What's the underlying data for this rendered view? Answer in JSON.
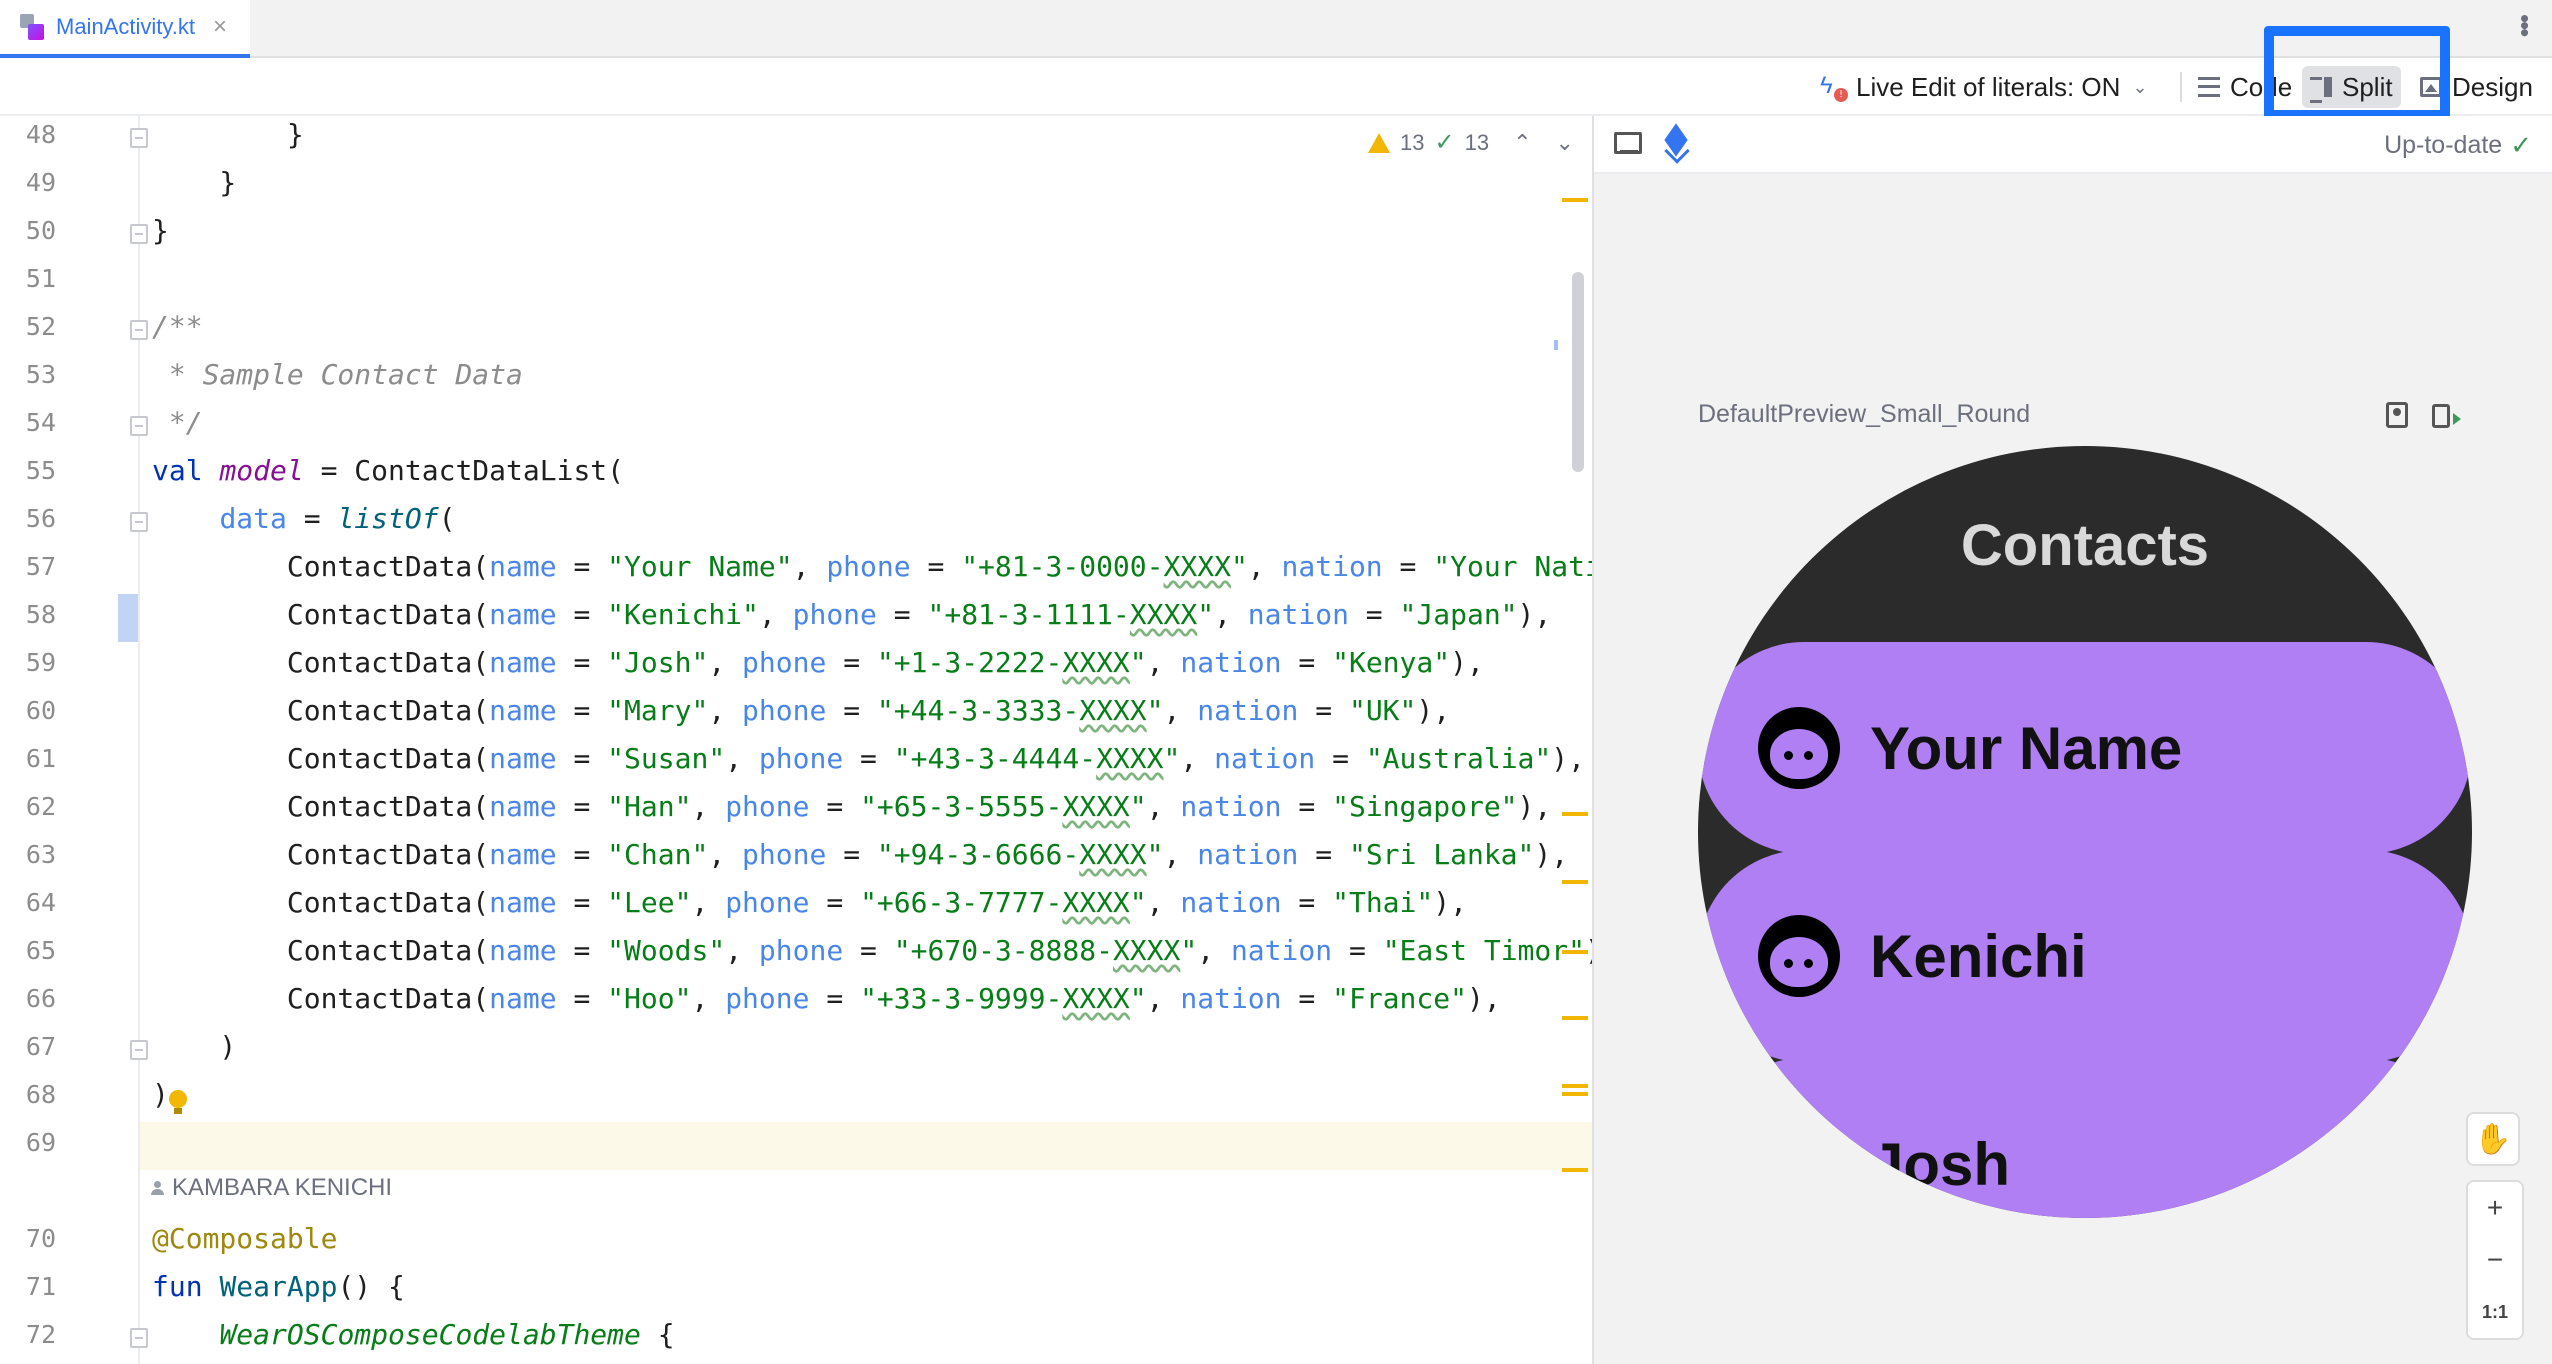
{
  "tab": {
    "title": "MainActivity.kt",
    "close": "×",
    "more": "⋮"
  },
  "toolbar": {
    "live_edit": "Live Edit of literals: ON",
    "live_edit_chevron": "⌄",
    "modes": {
      "code": "Code",
      "split": "Split",
      "design": "Design"
    },
    "selected_mode": "Split",
    "highlight_color": "#1a73ff"
  },
  "editor": {
    "inspections": {
      "warnings": "13",
      "checks": "13"
    },
    "line_numbers": [
      "48",
      "49",
      "50",
      "51",
      "52",
      "53",
      "54",
      "55",
      "56",
      "57",
      "58",
      "59",
      "60",
      "61",
      "62",
      "63",
      "64",
      "65",
      "66",
      "67",
      "68",
      "69",
      "70",
      "71",
      "72"
    ],
    "author": "KAMBARA KENICHI",
    "contacts": [
      {
        "name": "Your Name",
        "phone": "+81-3-0000-XXXX",
        "nation": "Your Nati"
      },
      {
        "name": "Kenichi",
        "phone": "+81-3-1111-XXXX",
        "nation": "Japan"
      },
      {
        "name": "Josh",
        "phone": "+1-3-2222-XXXX",
        "nation": "Kenya"
      },
      {
        "name": "Mary",
        "phone": "+44-3-3333-XXXX",
        "nation": "UK"
      },
      {
        "name": "Susan",
        "phone": "+43-3-4444-XXXX",
        "nation": "Australia"
      },
      {
        "name": "Han",
        "phone": "+65-3-5555-XXXX",
        "nation": "Singapore"
      },
      {
        "name": "Chan",
        "phone": "+94-3-6666-XXXX",
        "nation": "Sri Lanka"
      },
      {
        "name": "Lee",
        "phone": "+66-3-7777-XXXX",
        "nation": "Thai"
      },
      {
        "name": "Woods",
        "phone": "+670-3-8888-XXXX",
        "nation": "East Timor"
      },
      {
        "name": "Hoo",
        "phone": "+33-3-9999-XXXX",
        "nation": "France"
      }
    ],
    "code": {
      "l48": "        }",
      "l49": "    }",
      "l50": "}",
      "l52": "/**",
      "l53": " * Sample Contact Data",
      "l54": " */",
      "val_kw": "val",
      "model": "model",
      "l55_rest": " = ContactDataList(",
      "data_param": "data",
      "eq": " = ",
      "listof": "listOf",
      "paren_open": "(",
      "l67": "    )",
      "l68": ")",
      "annotation": "@Composable",
      "fun_kw": "fun",
      "fun_name": "WearApp",
      "fun_rest": "() {",
      "theme": "WearOSComposeCodelabTheme",
      "theme_rest": " {"
    }
  },
  "preview": {
    "status": "Up-to-date",
    "preview_name": "DefaultPreview_Small_Round",
    "watch": {
      "title": "Contacts",
      "chips": [
        "Your Name",
        "Kenichi",
        "Josh"
      ],
      "chip_color": "#b07ff3"
    },
    "zoom": {
      "in": "+",
      "out": "−",
      "actual": "1:1"
    }
  }
}
